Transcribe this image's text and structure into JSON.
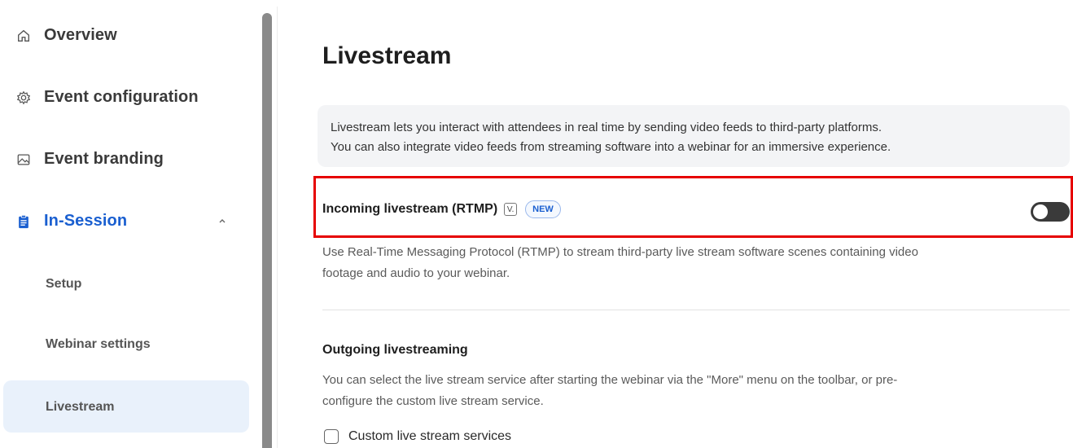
{
  "sidebar": {
    "items": [
      {
        "label": "Overview",
        "icon": "home-icon"
      },
      {
        "label": "Event configuration",
        "icon": "gear-icon"
      },
      {
        "label": "Event branding",
        "icon": "image-icon"
      },
      {
        "label": "In-Session",
        "icon": "clipboard-icon",
        "active": true
      }
    ],
    "sub_items": [
      {
        "label": "Setup"
      },
      {
        "label": "Webinar settings"
      },
      {
        "label": "Livestream",
        "active": true
      }
    ]
  },
  "main": {
    "title": "Livestream",
    "info_line1": "Livestream lets you interact with attendees in real time by sending video feeds to third-party platforms.",
    "info_line2": "You can also integrate video feeds from streaming software into a webinar for an immersive experience.",
    "incoming": {
      "title": "Incoming livestream (RTMP)",
      "v_icon_text": "V.",
      "badge": "NEW",
      "toggle_on": false,
      "desc_line1": "Use Real-Time Messaging Protocol (RTMP) to stream third-party live stream software scenes containing video",
      "desc_line2": "footage and audio to your webinar."
    },
    "outgoing": {
      "title": "Outgoing livestreaming",
      "desc_line1": "You can select the live stream service after starting the webinar via the \"More\" menu on the toolbar, or pre-",
      "desc_line2": "configure the custom live stream service.",
      "checkbox_label": "Custom live stream services",
      "checkbox_checked": false
    }
  },
  "colors": {
    "accent": "#1a5fd0",
    "highlight_border": "#e60000",
    "active_sub_bg": "#e9f1fb",
    "toggle_off": "#3a3a3a"
  }
}
